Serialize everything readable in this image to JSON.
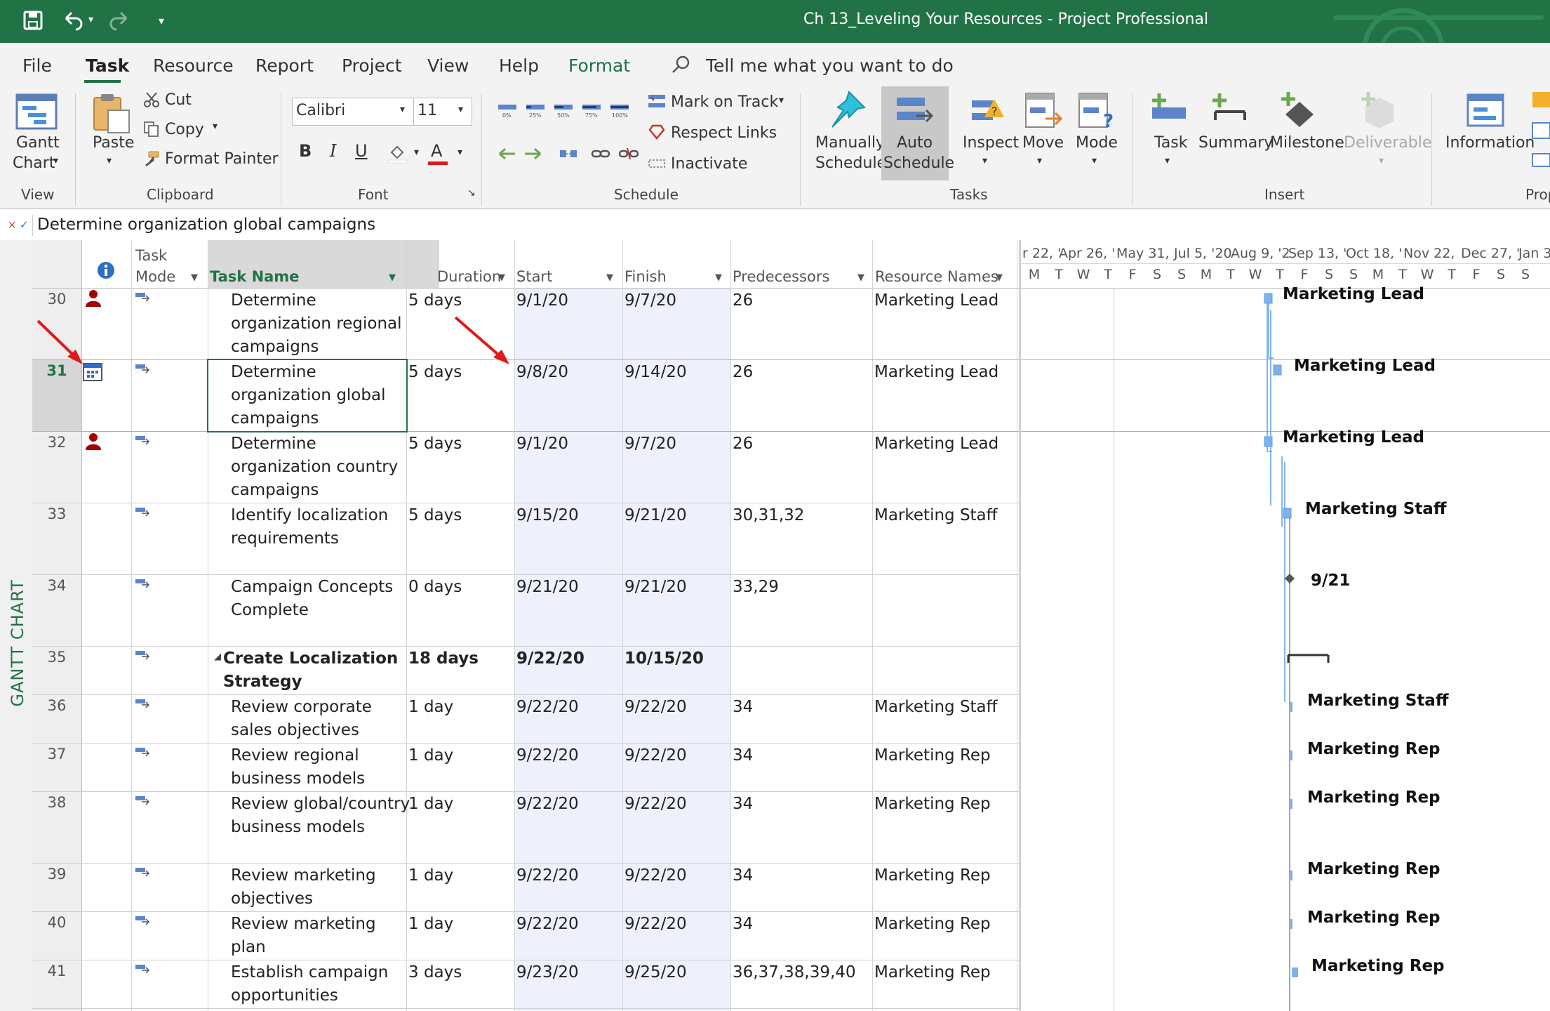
{
  "window": {
    "title": "Ch 13_Leveling Your Resources  -  Project Professional"
  },
  "tabs": [
    "File",
    "Task",
    "Resource",
    "Report",
    "Project",
    "View",
    "Help",
    "Format"
  ],
  "tell_me": "Tell me what you want to do",
  "ribbon": {
    "view": {
      "gantt": "Gantt",
      "chart": "Chart",
      "group": "View"
    },
    "clipboard": {
      "paste": "Paste",
      "cut": "Cut",
      "copy": "Copy",
      "format_painter": "Format Painter",
      "group": "Clipboard"
    },
    "font": {
      "name": "Calibri",
      "size": "11",
      "bold": "B",
      "italic": "I",
      "underline": "U",
      "color_letter": "A",
      "group": "Font"
    },
    "schedule": {
      "mark_on_track": "Mark on Track",
      "respect_links": "Respect Links",
      "inactivate": "Inactivate",
      "group": "Schedule",
      "pct": [
        "0%",
        "25%",
        "50%",
        "75%",
        "100%"
      ]
    },
    "tasks": {
      "manually": "Manually",
      "schedule1": "Schedule",
      "auto": "Auto",
      "schedule2": "Schedule",
      "inspect": "Inspect",
      "move": "Move",
      "mode": "Mode",
      "group": "Tasks"
    },
    "insert": {
      "task": "Task",
      "summary": "Summary",
      "milestone": "Milestone",
      "deliverable": "Deliverable",
      "group": "Insert"
    },
    "properties": {
      "information": "Information",
      "group": "Prop"
    }
  },
  "entry_bar": {
    "value": "Determine organization global campaigns"
  },
  "sidebar_label": "GANTT CHART",
  "columns": {
    "info": "i",
    "task_mode1": "Task",
    "task_mode2": "Mode",
    "task_name": "Task Name",
    "duration": "Duration",
    "start": "Start",
    "finish": "Finish",
    "predecessors": "Predecessors",
    "resources": "Resource Names"
  },
  "rows": [
    {
      "id": "30",
      "name1": "Determine",
      "name2": "organization regional",
      "name3": "campaigns",
      "duration": "5 days",
      "start": "9/1/20",
      "finish": "9/7/20",
      "pred": "26",
      "res": "Marketing Lead"
    },
    {
      "id": "31",
      "name1": "Determine",
      "name2": "organization global",
      "name3": "campaigns",
      "duration": "5 days",
      "start": "9/8/20",
      "finish": "9/14/20",
      "pred": "26",
      "res": "Marketing Lead"
    },
    {
      "id": "32",
      "name1": "Determine",
      "name2": "organization country",
      "name3": "campaigns",
      "duration": "5 days",
      "start": "9/1/20",
      "finish": "9/7/20",
      "pred": "26",
      "res": "Marketing Lead"
    },
    {
      "id": "33",
      "name1": "Identify localization",
      "name2": "requirements",
      "duration": "5 days",
      "start": "9/15/20",
      "finish": "9/21/20",
      "pred": "30,31,32",
      "res": "Marketing Staff"
    },
    {
      "id": "34",
      "name1": "Campaign Concepts",
      "name2": "Complete",
      "duration": "0 days",
      "start": "9/21/20",
      "finish": "9/21/20",
      "pred": "33,29",
      "res": ""
    },
    {
      "id": "35",
      "name1": "Create Localization",
      "name2": "Strategy",
      "duration": "18 days",
      "start": "9/22/20",
      "finish": "10/15/20",
      "pred": "",
      "res": ""
    },
    {
      "id": "36",
      "name1": "Review corporate",
      "name2": "sales objectives",
      "duration": "1 day",
      "start": "9/22/20",
      "finish": "9/22/20",
      "pred": "34",
      "res": "Marketing Staff"
    },
    {
      "id": "37",
      "name1": "Review regional",
      "name2": "business models",
      "duration": "1 day",
      "start": "9/22/20",
      "finish": "9/22/20",
      "pred": "34",
      "res": "Marketing Rep"
    },
    {
      "id": "38",
      "name1": "Review global/country",
      "name2": "business models",
      "duration": "1 day",
      "start": "9/22/20",
      "finish": "9/22/20",
      "pred": "34",
      "res": "Marketing Rep"
    },
    {
      "id": "39",
      "name1": "Review marketing",
      "name2": "objectives",
      "duration": "1 day",
      "start": "9/22/20",
      "finish": "9/22/20",
      "pred": "34",
      "res": "Marketing Rep"
    },
    {
      "id": "40",
      "name1": "Review marketing",
      "name2": "plan",
      "duration": "1 day",
      "start": "9/22/20",
      "finish": "9/22/20",
      "pred": "34",
      "res": "Marketing Rep"
    },
    {
      "id": "41",
      "name1": "Establish campaign",
      "name2": "opportunities",
      "duration": "3 days",
      "start": "9/23/20",
      "finish": "9/25/20",
      "pred": "36,37,38,39,40",
      "res": "Marketing Rep"
    }
  ],
  "timescale": {
    "top": [
      "r 22, '",
      "Apr 26, '",
      "May 31,",
      "Jul 5, '20",
      "Aug 9, '2",
      "Sep 13, '",
      "Oct 18, '",
      "Nov 22,",
      "Dec 27, '",
      "Jan 3"
    ],
    "days": [
      "M",
      "T",
      "W",
      "T",
      "F",
      "S",
      "S",
      "M",
      "T",
      "W",
      "T",
      "F",
      "S",
      "S",
      "M",
      "T",
      "W",
      "T",
      "F",
      "S",
      "S"
    ]
  },
  "gantt_labels": {
    "r30": "Marketing Lead",
    "r31": "Marketing Lead",
    "r32": "Marketing Lead",
    "r33": "Marketing Staff",
    "r34": "9/21",
    "r36": "Marketing Staff",
    "r37": "Marketing Rep",
    "r38": "Marketing Rep",
    "r39": "Marketing Rep",
    "r40": "Marketing Rep",
    "r41": "Marketing Rep"
  },
  "colors": {
    "accent": "#217346",
    "selection": "#eef0fb",
    "bar": "#7fb1ea",
    "arrow": "#e0191b",
    "person": "#a30000"
  }
}
